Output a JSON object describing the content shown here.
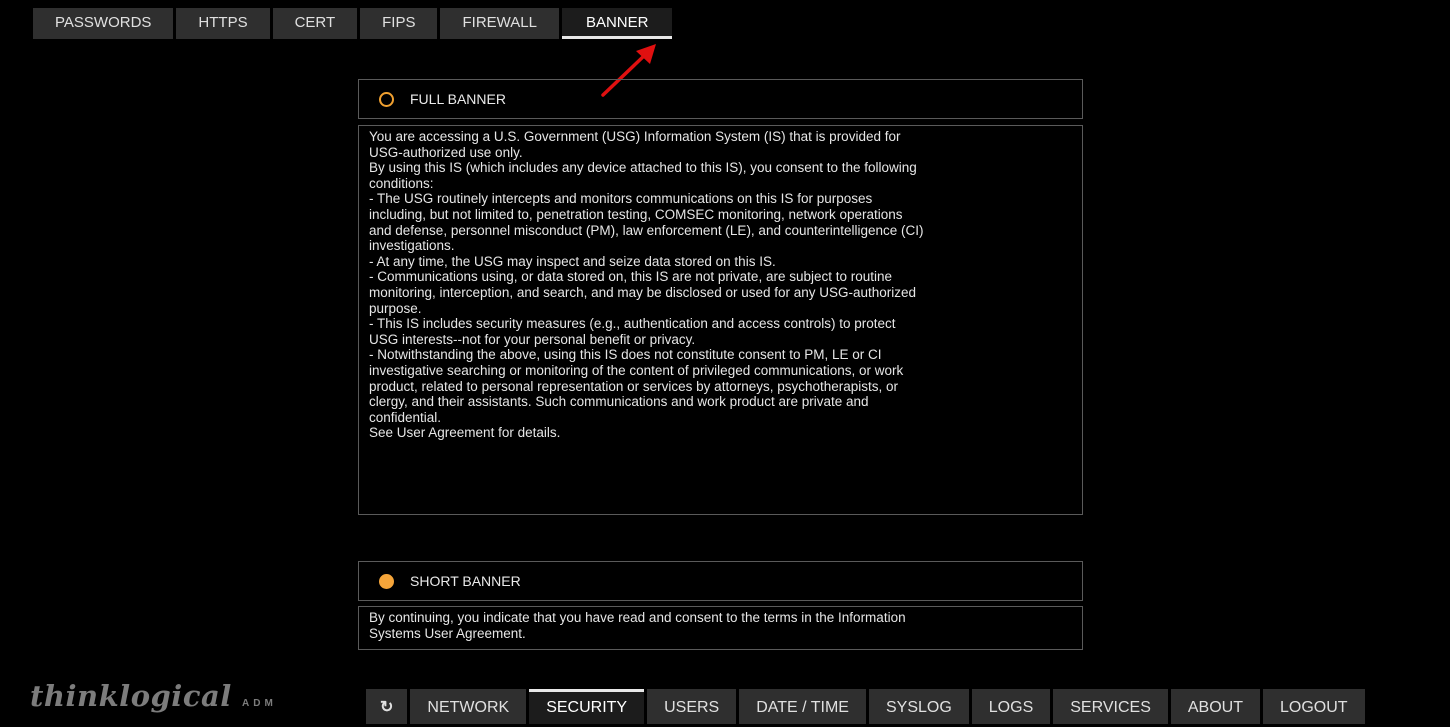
{
  "top_tabs": [
    "PASSWORDS",
    "HTTPS",
    "CERT",
    "FIPS",
    "FIREWALL",
    "BANNER"
  ],
  "active_top_tab": "BANNER",
  "full_banner": {
    "label": "FULL BANNER",
    "selected": false,
    "lines": [
      "You are accessing a U.S. Government (USG) Information System (IS) that is provided for",
      "USG-authorized use only.",
      "By using this IS (which includes any device attached to this IS), you consent to the following",
      "conditions:",
      "- The USG routinely intercepts and monitors communications on this IS for purposes",
      "including, but not limited to, penetration testing, COMSEC monitoring, network operations",
      "and defense, personnel misconduct (PM), law enforcement (LE), and counterintelligence (CI)",
      "investigations.",
      "- At any time, the USG may inspect and seize data stored on this IS.",
      "- Communications using, or data stored on, this IS are not private, are subject to routine",
      "monitoring, interception, and search, and may be disclosed or used for any USG-authorized",
      "purpose.",
      "- This IS includes security measures (e.g., authentication and access controls) to protect",
      "USG interests--not for your personal benefit or privacy.",
      "- Notwithstanding the above, using this IS does not constitute consent to PM, LE or CI",
      "investigative searching or monitoring of the content of privileged communications, or work",
      "product, related to personal representation or services by attorneys, psychotherapists, or",
      "clergy, and their assistants. Such communications and work product are private and",
      "confidential.",
      "See User Agreement for details."
    ]
  },
  "short_banner": {
    "label": "SHORT BANNER",
    "selected": true,
    "lines": [
      "By continuing, you indicate that you have read and consent to the terms in the Information",
      "Systems User Agreement."
    ]
  },
  "logo": {
    "text": "thinklogical",
    "suffix": "ADM"
  },
  "bottom_nav": {
    "refresh_icon": "↻",
    "items": [
      "NETWORK",
      "SECURITY",
      "USERS",
      "DATE / TIME",
      "SYSLOG",
      "LOGS",
      "SERVICES",
      "ABOUT",
      "LOGOUT"
    ],
    "active": "SECURITY"
  },
  "colors": {
    "accent": "#f5a53a",
    "arrow": "#e01010",
    "tab_bg": "#2f2f2f"
  }
}
